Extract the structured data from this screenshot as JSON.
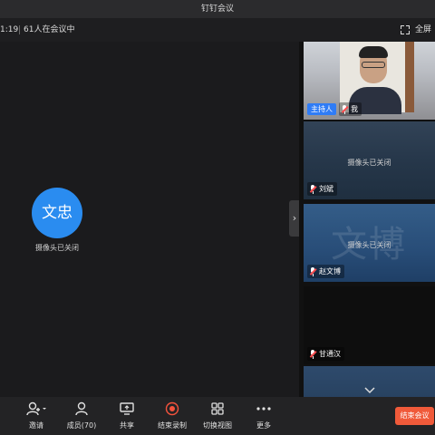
{
  "window": {
    "title": "钉钉会议"
  },
  "info_bar": {
    "timer": "1:19",
    "participants_in_meeting": "61人在会议中",
    "fullscreen_label": "全屏"
  },
  "main_stage": {
    "avatar_text": "文忠",
    "camera_status": "摄像头已关闭"
  },
  "participants": [
    {
      "host_badge": "主持人",
      "name": "我",
      "mic": "muted",
      "camera": "on"
    },
    {
      "name": "刘斌",
      "mic": "muted",
      "camera_status": "摄像头已关闭"
    },
    {
      "name": "赵文博",
      "mic": "muted",
      "camera_status": "摄像头已关闭",
      "watermark": "文博"
    },
    {
      "name": "甘通汉",
      "mic": "muted"
    }
  ],
  "toolbar": {
    "invite": "邀请",
    "members": "成员(70)",
    "share": "共享",
    "stop_recording": "结束录制",
    "switch_view": "切换视图",
    "more": "更多",
    "end_meeting": "结束会议"
  },
  "colors": {
    "accent": "#2a8cf0",
    "host_badge": "#2f7cf6",
    "end_button": "#f05a3a",
    "record": "#f5533d"
  }
}
